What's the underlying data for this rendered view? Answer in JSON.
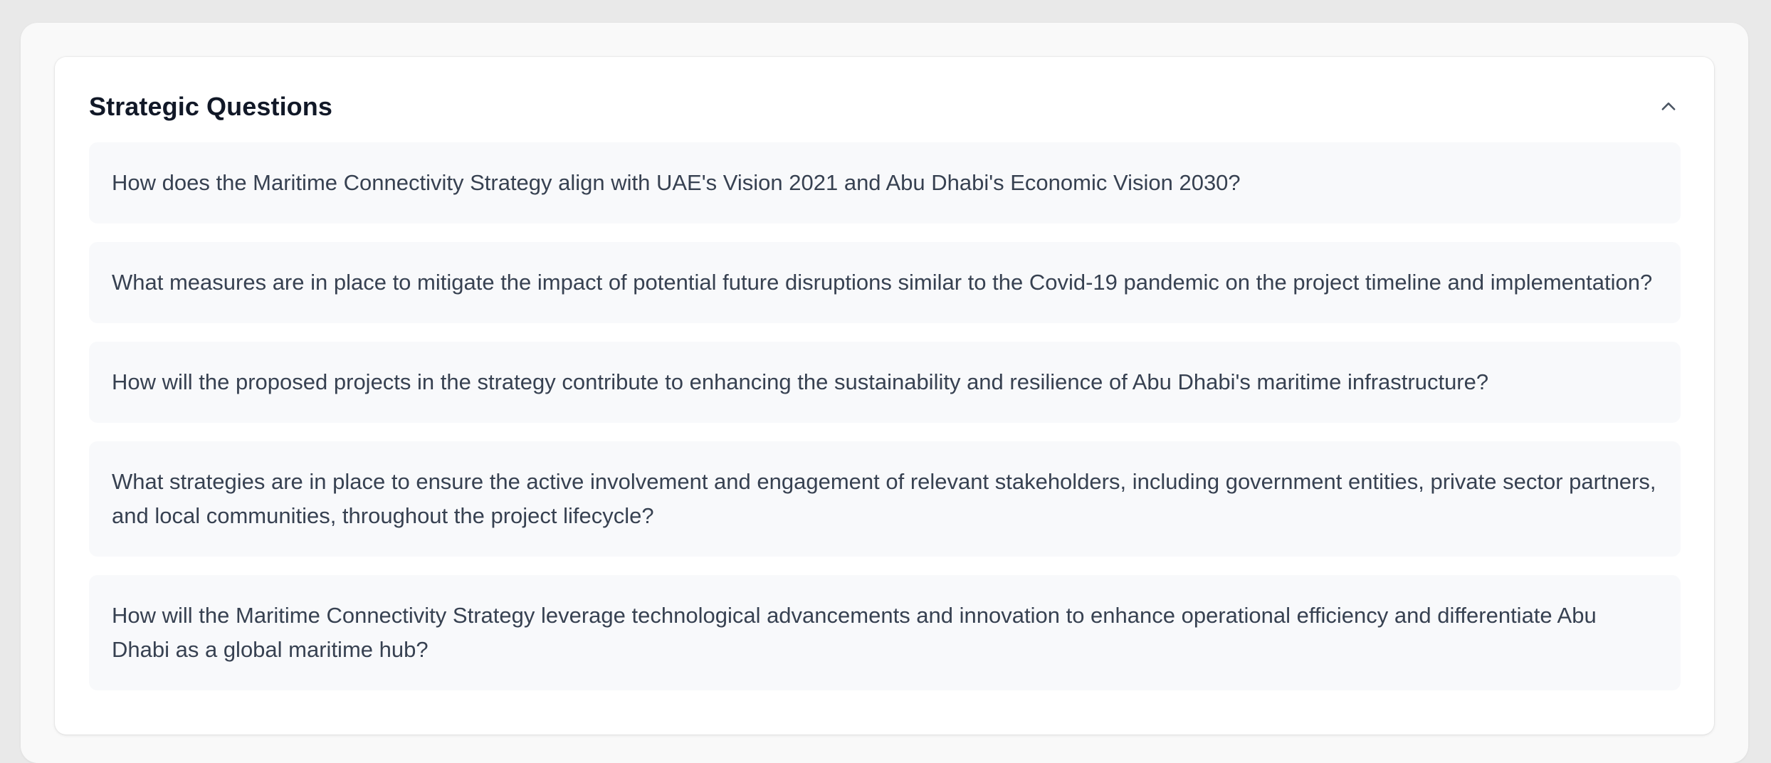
{
  "section": {
    "title": "Strategic Questions",
    "collapse_icon": "chevron-up-icon"
  },
  "questions": [
    "How does the Maritime Connectivity Strategy align with UAE's Vision 2021 and Abu Dhabi's Economic Vision 2030?",
    "What measures are in place to mitigate the impact of potential future disruptions similar to the Covid-19 pandemic on the project timeline and implementation?",
    "How will the proposed projects in the strategy contribute to enhancing the sustainability and resilience of Abu Dhabi's maritime infrastructure?",
    "What strategies are in place to ensure the active involvement and engagement of relevant stakeholders, including government entities, private sector partners, and local communities, throughout the project lifecycle?",
    "How will the Maritime Connectivity Strategy leverage technological advancements and innovation to enhance operational efficiency and differentiate Abu Dhabi as a global maritime hub?"
  ],
  "colors": {
    "page_bg": "#e9e9e9",
    "card_bg": "#ffffff",
    "item_bg": "#f8f9fb",
    "title_text": "#111827",
    "body_text": "#374151"
  }
}
